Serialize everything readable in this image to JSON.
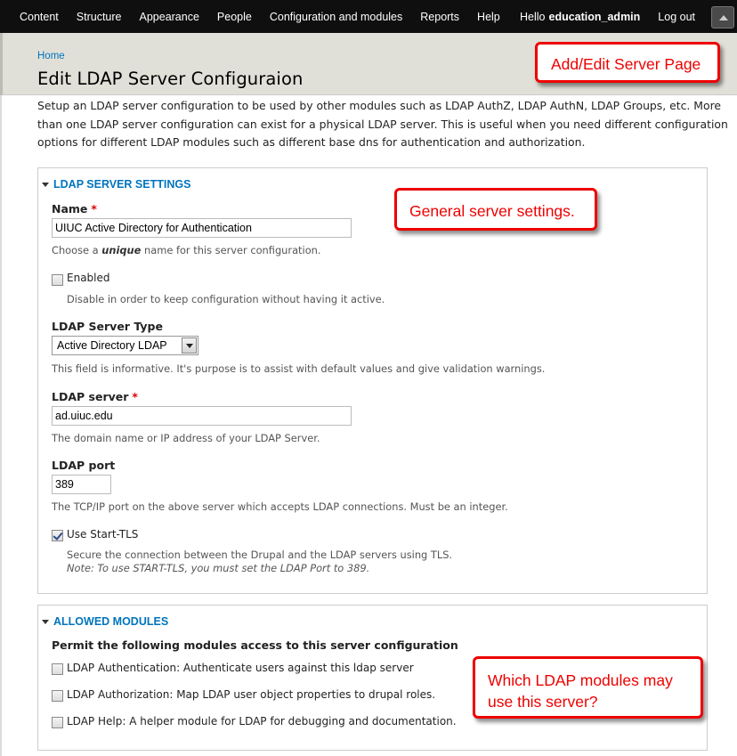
{
  "toolbar": {
    "menu": [
      "Content",
      "Structure",
      "Appearance",
      "People",
      "Configuration and modules",
      "Reports",
      "Help"
    ],
    "hello": "Hello",
    "username": "education_admin",
    "logout": "Log out"
  },
  "header": {
    "breadcrumb": "Home",
    "title": "Edit LDAP Server Configuraion"
  },
  "description": "Setup an LDAP server configuration to be used by other modules such as LDAP AuthZ, LDAP AuthN, LDAP Groups, etc. More than one LDAP server configuration can exist for a physical LDAP server. This is useful when you need different configuration options for different LDAP modules such as different base dns for authentication and authorization.",
  "server_settings": {
    "legend": "LDAP SERVER SETTINGS",
    "name": {
      "label": "Name",
      "required": "*",
      "value": "UIUC Active Directory for Authentication",
      "help_prefix": "Choose a",
      "help_em": "unique",
      "help_suffix": "name for this server configuration."
    },
    "enabled": {
      "label": "Enabled",
      "checked": false,
      "help": "Disable in order to keep configuration without having it active."
    },
    "server_type": {
      "label": "LDAP Server Type",
      "value": "Active Directory LDAP",
      "help": "This field is informative. It's purpose is to assist with default values and give validation warnings."
    },
    "server": {
      "label": "LDAP server",
      "required": "*",
      "value": "ad.uiuc.edu",
      "help": "The domain name or IP address of your LDAP Server."
    },
    "port": {
      "label": "LDAP port",
      "value": "389",
      "help": "The TCP/IP port on the above server which accepts LDAP connections. Must be an integer."
    },
    "start_tls": {
      "label": "Use Start-TLS",
      "checked": true,
      "help": "Secure the connection between the Drupal and the LDAP servers using TLS.",
      "note": "Note: To use START-TLS, you must set the LDAP Port to 389."
    }
  },
  "allowed_modules": {
    "legend": "ALLOWED MODULES",
    "heading": "Permit the following modules access to this server configuration",
    "modules": [
      "LDAP Authentication: Authenticate users against this ldap server",
      "LDAP Authorization: Map LDAP user object properties to drupal roles.",
      "LDAP Help: A helper module for LDAP for debugging and documentation."
    ]
  },
  "callouts": {
    "page": "Add/Edit Server Page",
    "general": "General server settings.",
    "modules_line1": "Which LDAP modules may",
    "modules_line2": "use this server?"
  },
  "colors": {
    "link": "#0074bd",
    "required": "#dd0000",
    "callout": "#ee0000",
    "toolbar": "#0f0f0f",
    "header_bg": "#e0e0d8"
  }
}
